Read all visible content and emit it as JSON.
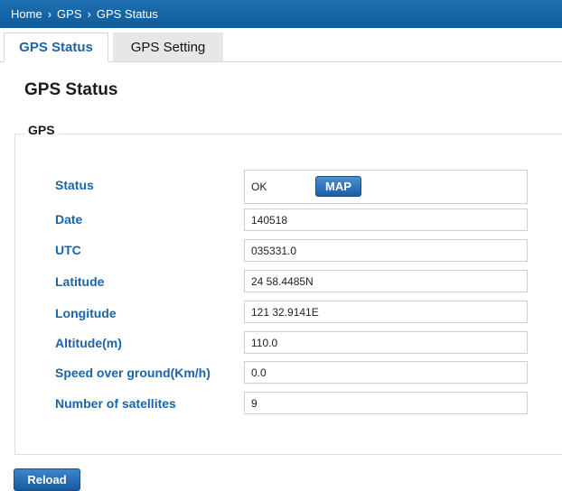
{
  "breadcrumb": {
    "items": [
      "Home",
      "GPS",
      "GPS Status"
    ],
    "separator": "›"
  },
  "tabs": [
    {
      "label": "GPS Status",
      "active": true
    },
    {
      "label": "GPS Setting",
      "active": false
    }
  ],
  "page_title": "GPS Status",
  "section": {
    "legend": "GPS",
    "status": {
      "label": "Status",
      "value": "OK",
      "map_button": "MAP"
    },
    "fields": [
      {
        "label": "Date",
        "value": "140518"
      },
      {
        "label": "UTC",
        "value": "035331.0"
      },
      {
        "label": "Latitude",
        "value": "24 58.4485N"
      },
      {
        "label": "Longitude",
        "value": "121 32.9141E"
      },
      {
        "label": "Altitude(m)",
        "value": "110.0"
      },
      {
        "label": "Speed over ground(Km/h)",
        "value": "0.0"
      },
      {
        "label": "Number of satellites",
        "value": "9"
      }
    ]
  },
  "reload_button": "Reload",
  "colors": {
    "header_bar": "#0d5d9e",
    "label_blue": "#1a64a8",
    "button_blue": "#1a5fa6"
  }
}
